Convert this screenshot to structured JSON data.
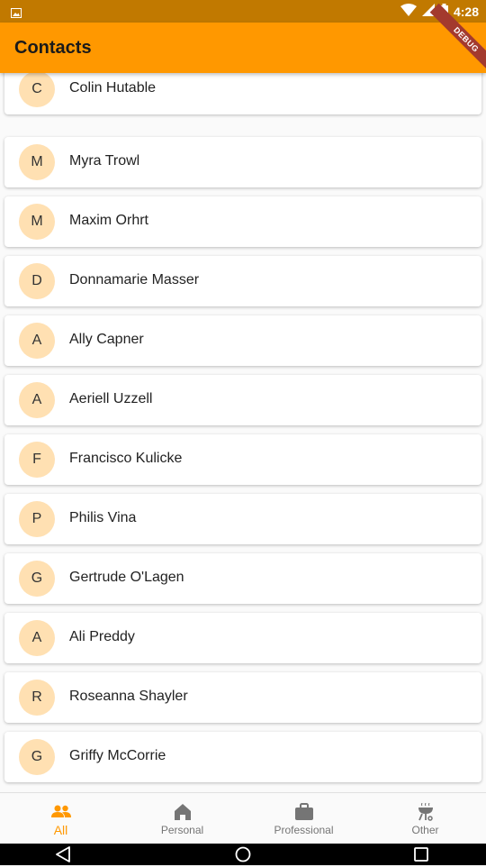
{
  "status_bar": {
    "time": "4:28"
  },
  "app_bar": {
    "title": "Contacts",
    "debug_label": "DEBUG"
  },
  "contacts": [
    {
      "initial": "C",
      "name": "Colin Hutable"
    },
    {
      "initial": "M",
      "name": "Myra Trowl"
    },
    {
      "initial": "M",
      "name": "Maxim Orhrt"
    },
    {
      "initial": "D",
      "name": "Donnamarie Masser"
    },
    {
      "initial": "A",
      "name": "Ally Capner"
    },
    {
      "initial": "A",
      "name": "Aeriell Uzzell"
    },
    {
      "initial": "F",
      "name": "Francisco Kulicke"
    },
    {
      "initial": "P",
      "name": "Philis Vina"
    },
    {
      "initial": "G",
      "name": "Gertrude O'Lagen"
    },
    {
      "initial": "A",
      "name": "Ali Preddy"
    },
    {
      "initial": "R",
      "name": "Roseanna Shayler"
    },
    {
      "initial": "G",
      "name": "Griffy McCorrie"
    }
  ],
  "bottom_nav": {
    "items": [
      {
        "label": "All",
        "icon": "people-icon",
        "active": true
      },
      {
        "label": "Personal",
        "icon": "home-icon",
        "active": false
      },
      {
        "label": "Professional",
        "icon": "briefcase-icon",
        "active": false
      },
      {
        "label": "Other",
        "icon": "grill-icon",
        "active": false
      }
    ]
  },
  "colors": {
    "primary": "#ff9800",
    "status_bar": "#c17900",
    "avatar_bg": "#ffe0b2",
    "active_nav": "#ff9800",
    "inactive_nav": "#757575"
  }
}
